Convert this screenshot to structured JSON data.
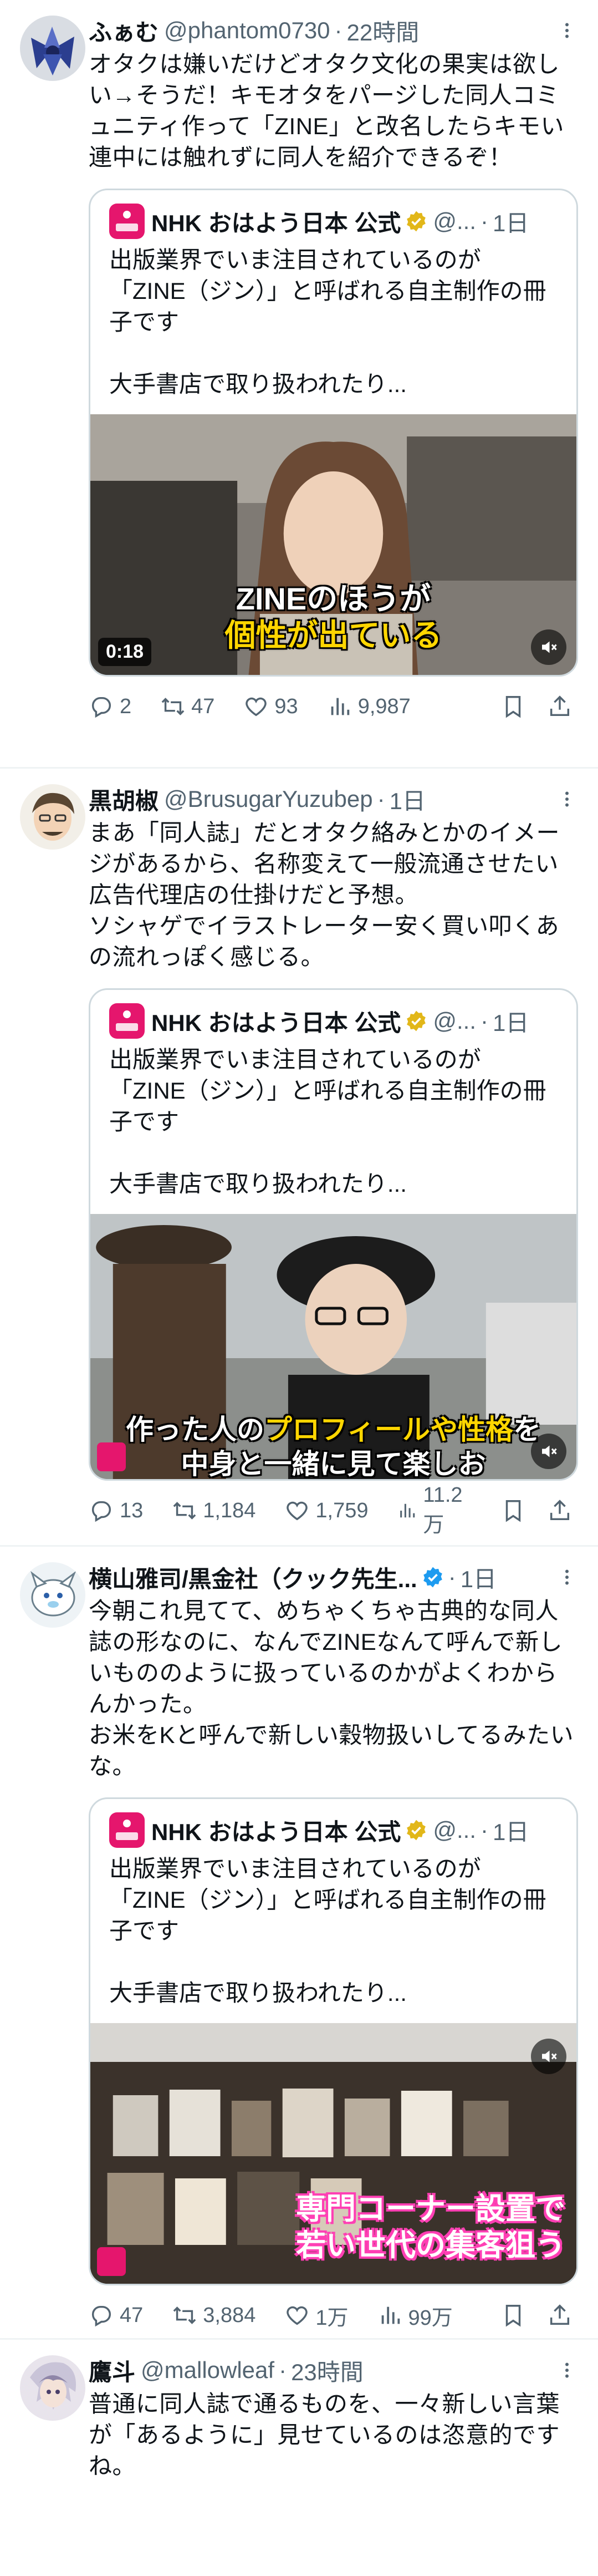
{
  "tweets": [
    {
      "name": "ふぁむ",
      "handle": "@phantom0730",
      "dot": "·",
      "time": "22時間",
      "text": "オタクは嫌いだけどオタク文化の果実は欲しい→そうだ！キモオタをパージした同人コミュニティ作って「ZINE」と改名したらキモい連中には触れずに同人を紹介できるぞ！",
      "quote": {
        "name": "NHK おはよう日本 公式",
        "handle": "@...",
        "dot": "·",
        "time": "1日",
        "text": "出版業界でいま注目されているのが\n「ZINE（ジン）」と呼ばれる自主制作の冊子です\n\n大手書店で取り扱われたり...",
        "caption_line1": "ZINEのほうが",
        "caption_line2": "個性が出ている",
        "duration": "0:18"
      },
      "replies": "2",
      "retweets": "47",
      "likes": "93",
      "views": "9,987"
    },
    {
      "name": "黒胡椒",
      "handle": "@BrusugarYuzubep",
      "dot": "·",
      "time": "1日",
      "text": "まあ「同人誌」だとオタク絡みとかのイメージがあるから、名称変えて一般流通させたい広告代理店の仕掛けだと予想。\nソシャゲでイラストレーター安く買い叩くあの流れっぽく感じる。",
      "quote": {
        "name": "NHK おはよう日本 公式",
        "handle": "@...",
        "dot": "·",
        "time": "1日",
        "text": "出版業界でいま注目されているのが\n「ZINE（ジン）」と呼ばれる自主制作の冊子です\n\n大手書店で取り扱われたり...",
        "caption_line1_a": "作った人の",
        "caption_line1_b": "プロフィールや性格",
        "caption_line1_c": "を",
        "caption_line2": "中身と一緒に見て楽しお"
      },
      "replies": "13",
      "retweets": "1,184",
      "likes": "1,759",
      "views": "11.2万"
    },
    {
      "name": "横山雅司/黒金社（クック先生...",
      "handle": "",
      "dot": "·",
      "time": "1日",
      "text": "今朝これ見てて、めちゃくちゃ古典的な同人誌の形なのに、なんでZINEなんて呼んで新しいもののように扱っているのかがよくわからんかった。\nお米をKと呼んで新しい穀物扱いしてるみたいな。",
      "quote": {
        "name": "NHK おはよう日本 公式",
        "handle": "@...",
        "dot": "·",
        "time": "1日",
        "text": "出版業界でいま注目されているのが\n「ZINE（ジン）」と呼ばれる自主制作の冊子です\n\n大手書店で取り扱われたり...",
        "caption_line1": "専門コーナー設置で",
        "caption_line2": "若い世代の集客狙う"
      },
      "replies": "47",
      "retweets": "3,884",
      "likes": "1万",
      "views": "99万"
    },
    {
      "name": "鷹斗",
      "handle": "@mallowleaf",
      "dot": "·",
      "time": "23時間",
      "text": "普通に同人誌で通るものを、一々新しい言葉が「あるように」見せているのは恣意的ですね。"
    }
  ],
  "colors": {
    "text": "#0f1419",
    "secondary": "#536471",
    "border": "#cfd9de",
    "divider": "#eff3f4",
    "gold_badge": "#e2b719",
    "blue_badge": "#1d9bf0",
    "nhk_pink": "#e5166d",
    "caption_yellow": "#ffd600",
    "caption_pink": "#ff3fb4"
  },
  "icons": [
    "more-icon",
    "reply-icon",
    "retweet-icon",
    "like-icon",
    "views-icon",
    "bookmark-icon",
    "share-icon",
    "mute-icon",
    "verified-gold-icon",
    "verified-blue-icon"
  ]
}
